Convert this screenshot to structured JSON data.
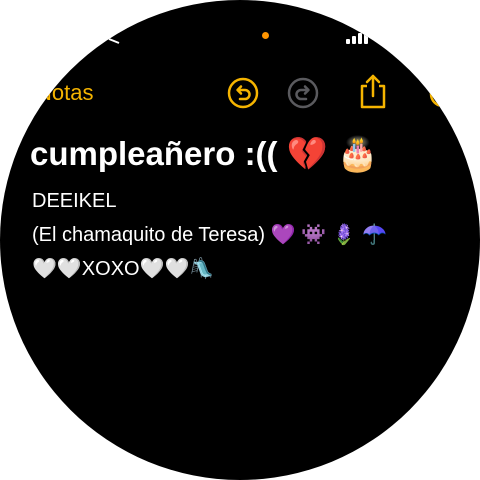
{
  "status_bar": {
    "location_dot_color": "#ff9500"
  },
  "nav": {
    "back_label": "Notas",
    "accent_color": "#f5b400",
    "icons": [
      "undo-icon",
      "redo-icon",
      "share-icon",
      "more-icon"
    ]
  },
  "note": {
    "title": "cumpleañero :(( 💔 🎂",
    "lines": [
      "DEEIKEL",
      "(El chamaquito de Teresa) 💜 👾 🪻 ☂️",
      "🤍🤍XOXO🤍🤍🛝"
    ]
  }
}
